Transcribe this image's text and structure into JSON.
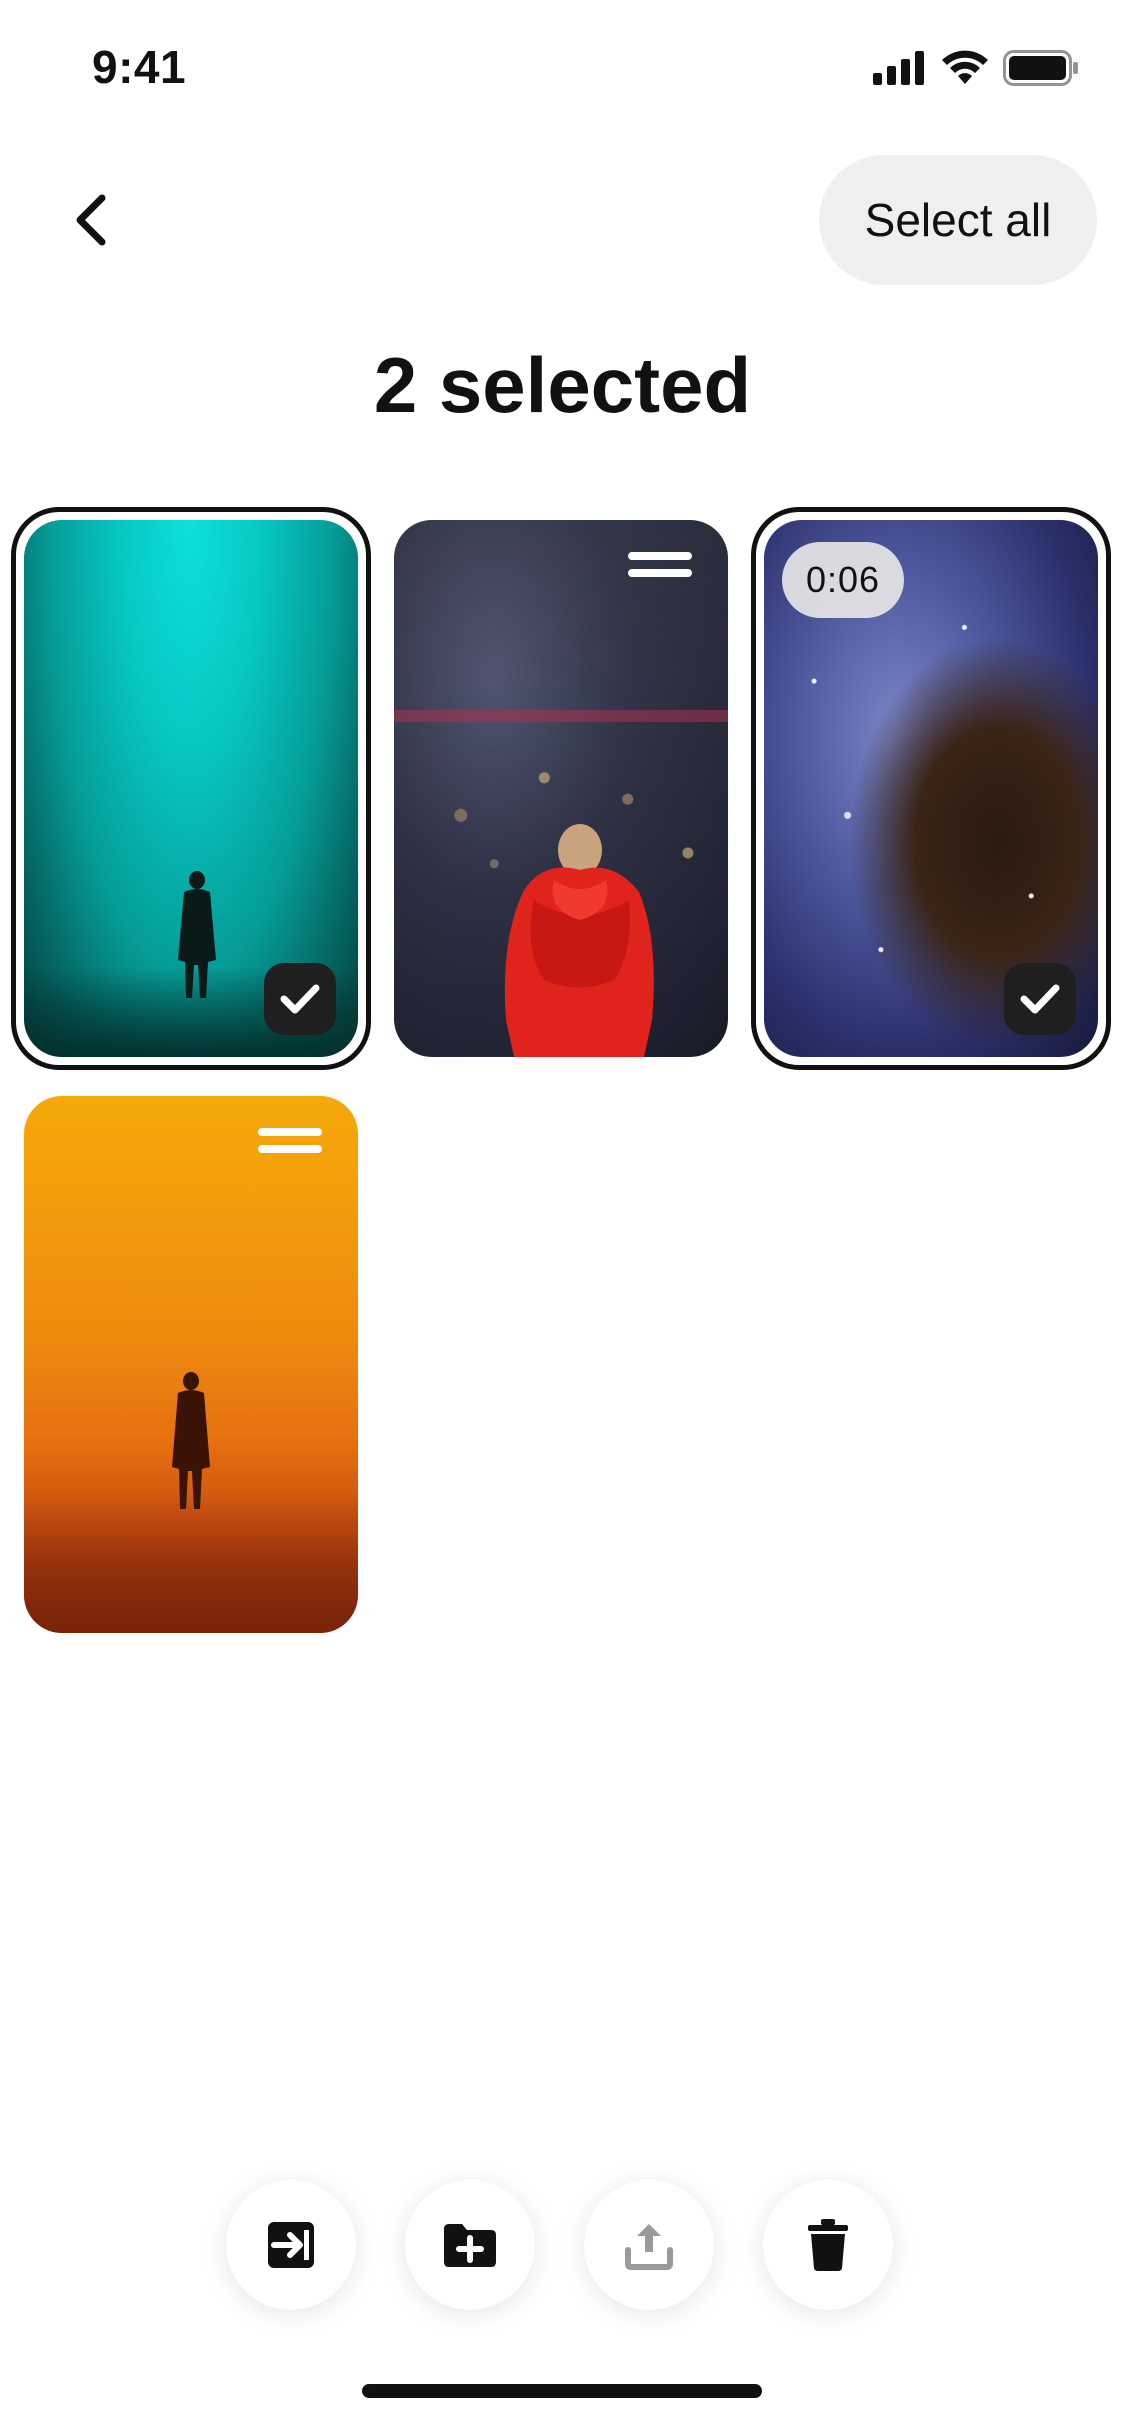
{
  "status_bar": {
    "time": "9:41",
    "icons": [
      "cellular-signal-icon",
      "wifi-icon",
      "battery-icon"
    ]
  },
  "header": {
    "back_icon": "chevron-left-icon",
    "select_all_label": "Select all",
    "title": "2 selected"
  },
  "grid": {
    "items": [
      {
        "image": "teal fog figure",
        "selected": true,
        "badge": "check-icon"
      },
      {
        "image": "red puffer performer",
        "selected": false,
        "badge": "menu-lines-icon"
      },
      {
        "image": "nebula starfield",
        "selected": true,
        "badge": "check-icon",
        "duration": "0:06"
      },
      {
        "image": "orange haze figure",
        "selected": false,
        "badge": "menu-lines-icon"
      }
    ]
  },
  "action_bar": {
    "buttons": [
      {
        "icon": "move-to-icon",
        "enabled": true
      },
      {
        "icon": "add-to-folder-icon",
        "enabled": true
      },
      {
        "icon": "share-icon",
        "enabled": false
      },
      {
        "icon": "trash-icon",
        "enabled": true
      }
    ]
  },
  "colors": {
    "text": "#111111",
    "pill_bg": "#efefef",
    "disabled_icon": "#9a9a9a"
  }
}
